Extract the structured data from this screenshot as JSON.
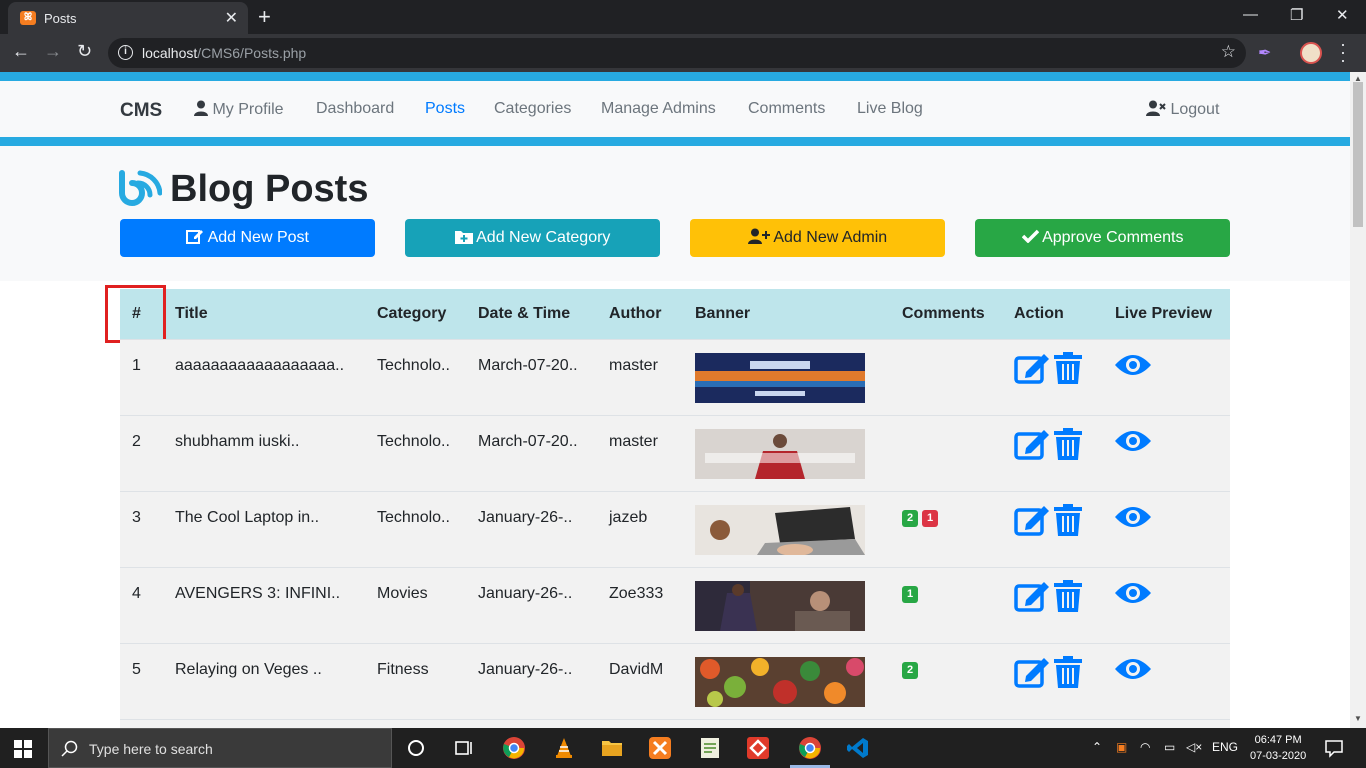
{
  "browser": {
    "tab_title": "Posts",
    "tab_close": "✕",
    "new_tab": "+",
    "url_host": "localhost",
    "url_path": "/CMS6/Posts.php"
  },
  "navbar": {
    "brand": "CMS",
    "items": [
      {
        "label": "My Profile",
        "icon": "user-icon"
      },
      {
        "label": "Dashboard"
      },
      {
        "label": "Posts",
        "active": true
      },
      {
        "label": "Categories"
      },
      {
        "label": "Manage Admins"
      },
      {
        "label": "Comments"
      },
      {
        "label": "Live Blog"
      }
    ],
    "logout": "Logout"
  },
  "header": {
    "title": "Blog Posts",
    "buttons": [
      {
        "label": "Add New Post",
        "icon": "edit-icon",
        "color": "#007bff"
      },
      {
        "label": "Add New Category",
        "icon": "folder-plus-icon",
        "color": "#17a2b8"
      },
      {
        "label": "Add New Admin",
        "icon": "user-plus-icon",
        "color": "#ffc107"
      },
      {
        "label": "Approve Comments",
        "icon": "check-icon",
        "color": "#28a745"
      }
    ]
  },
  "table": {
    "columns": [
      "#",
      "Title",
      "Category",
      "Date & Time",
      "Author",
      "Banner",
      "Comments",
      "Action",
      "Live Preview"
    ],
    "rows": [
      {
        "num": "1",
        "title": "aaaaaaaaaaaaaaaaaa..",
        "category": "Technolo..",
        "date": "March-07-20..",
        "author": "master",
        "approved": "",
        "pending": ""
      },
      {
        "num": "2",
        "title": "shubhamm iuski..",
        "category": "Technolo..",
        "date": "March-07-20..",
        "author": "master",
        "approved": "",
        "pending": ""
      },
      {
        "num": "3",
        "title": "The Cool Laptop in..",
        "category": "Technolo..",
        "date": "January-26-..",
        "author": "jazeb",
        "approved": "2",
        "pending": "1"
      },
      {
        "num": "4",
        "title": "AVENGERS 3: INFINI..",
        "category": "Movies",
        "date": "January-26-..",
        "author": "Zoe333",
        "approved": "1",
        "pending": ""
      },
      {
        "num": "5",
        "title": "Relaying on Veges ..",
        "category": "Fitness",
        "date": "January-26-..",
        "author": "DavidM",
        "approved": "2",
        "pending": ""
      }
    ]
  },
  "taskbar": {
    "search_placeholder": "Type here to search",
    "lang": "ENG",
    "time": "06:47 PM",
    "date": "07-03-2020"
  },
  "colors": {
    "accent_bar": "#27aae1",
    "primary": "#007bff",
    "table_head": "#bee5eb"
  }
}
